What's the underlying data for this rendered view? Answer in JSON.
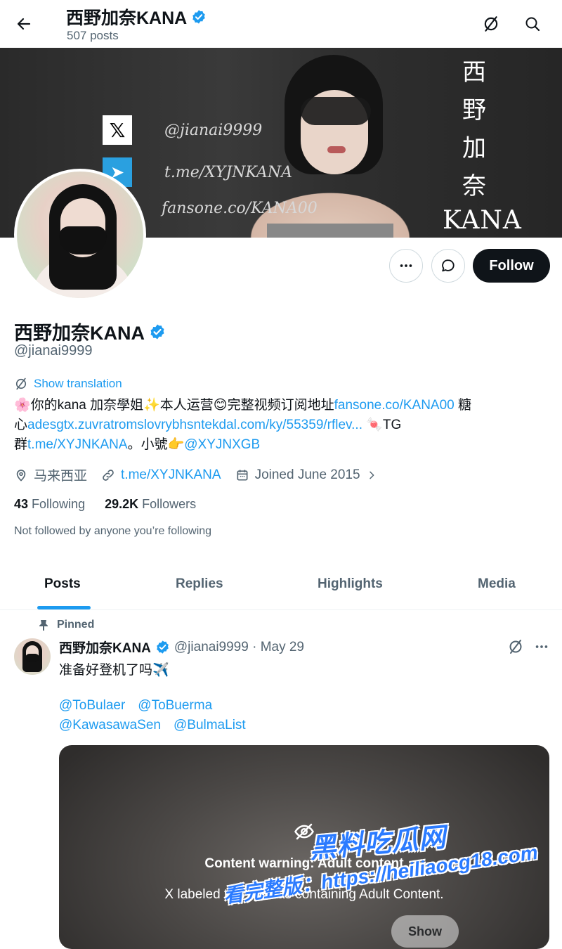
{
  "header": {
    "title": "西野加奈KANA",
    "posts_count": "507 posts"
  },
  "banner": {
    "x_handle": "@jianai9999",
    "telegram": "t.me/XYJNKANA",
    "fansone": "fansone.co/KANA00",
    "vertical_name": [
      "西",
      "野",
      "加",
      "奈"
    ],
    "latin_name": "KANA"
  },
  "profile": {
    "follow_label": "Follow",
    "display_name": "西野加奈KANA",
    "handle": "@jianai9999",
    "show_translation": "Show translation",
    "bio_line1_a": "🌸你的kana 加奈學姐✨本人运营😊完整视频订阅地址",
    "bio_line1_link": "fansone.co/KANA00",
    "bio_line1_b": " 糖",
    "bio_line2_a": "心",
    "bio_line2_link": "adesgtx.zuvratromslovrybhsntekdal.com/ky/55359/rflev...",
    "bio_line2_b": " 🍬TG",
    "bio_line3_a": "群",
    "bio_line3_link": "t.me/XYJNKANA",
    "bio_line3_b": "。小號👉",
    "bio_line3_link2": "@XYJNXGB",
    "location": "马来西亚",
    "website": "t.me/XYJNKANA",
    "joined": "Joined June 2015",
    "following_count": "43",
    "following_label": "Following",
    "followers_count": "29.2K",
    "followers_label": "Followers",
    "not_followed": "Not followed by anyone you’re following"
  },
  "tabs": [
    "Posts",
    "Replies",
    "Highlights",
    "Media"
  ],
  "pinned_post": {
    "pinned_label": "Pinned",
    "author": "西野加奈KANA",
    "handle_date": "@jianai9999 · May 29",
    "text": "准备好登机了吗✈️",
    "mentions": [
      "@ToBulaer",
      "@ToBuerma",
      "@KawasawaSen",
      "@BulmaList"
    ],
    "cw_title": "Content warning: Adult content",
    "cw_desc": "X labeled this post as containing Adult Content.",
    "show_label": "Show"
  },
  "watermark": {
    "line1": "黑料吃瓜网",
    "line2": "看完整版：https://heiliaocg18.com"
  },
  "colors": {
    "accent": "#1d9bf0",
    "text": "#0f1419",
    "muted": "#536471"
  }
}
